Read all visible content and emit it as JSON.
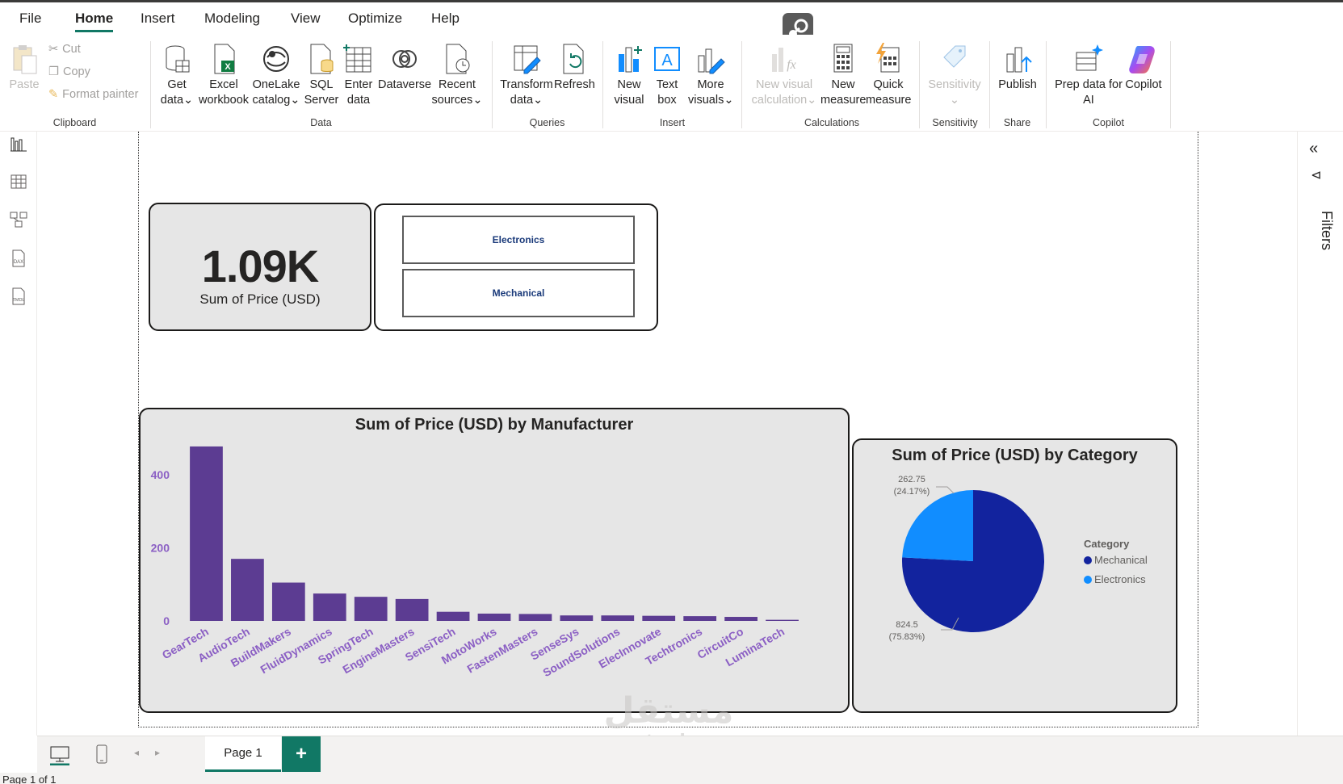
{
  "menu": {
    "tabs": [
      {
        "label": "File",
        "active": false
      },
      {
        "label": "Home",
        "active": true
      },
      {
        "label": "Insert",
        "active": false
      },
      {
        "label": "Modeling",
        "active": false
      },
      {
        "label": "View",
        "active": false
      },
      {
        "label": "Optimize",
        "active": false
      },
      {
        "label": "Help",
        "active": false
      }
    ]
  },
  "ribbon": {
    "clipboard": {
      "paste": "Paste",
      "cut": "Cut",
      "copy": "Copy",
      "format_painter": "Format painter",
      "group": "Clipboard"
    },
    "data": {
      "get_data": [
        "Get",
        "data"
      ],
      "excel": [
        "Excel",
        "workbook"
      ],
      "onelake": [
        "OneLake",
        "catalog"
      ],
      "sql": [
        "SQL",
        "Server"
      ],
      "enter": [
        "Enter",
        "data"
      ],
      "dataverse": [
        "Dataverse"
      ],
      "recent": [
        "Recent",
        "sources"
      ],
      "group": "Data"
    },
    "queries": {
      "transform": [
        "Transform",
        "data"
      ],
      "refresh": [
        "Refresh"
      ],
      "group": "Queries"
    },
    "insert": {
      "new_visual": [
        "New",
        "visual"
      ],
      "text_box": [
        "Text",
        "box"
      ],
      "more_visuals": [
        "More",
        "visuals"
      ],
      "group": "Insert"
    },
    "calculations": {
      "new_visual_calc": [
        "New visual",
        "calculation"
      ],
      "new_measure": [
        "New",
        "measure"
      ],
      "quick_measure": [
        "Quick",
        "measure"
      ],
      "group": "Calculations"
    },
    "sensitivity": {
      "label": [
        "Sensitivity"
      ],
      "group": "Sensitivity"
    },
    "share": {
      "publish": [
        "Publish"
      ],
      "group": "Share"
    },
    "copilot": {
      "prep": [
        "Prep data for",
        "AI"
      ],
      "copilot": [
        "Copilot"
      ],
      "group": "Copilot"
    }
  },
  "card": {
    "value": "1.09K",
    "label": "Sum of Price (USD)"
  },
  "slicer": {
    "items": [
      "Electronics",
      "Mechanical"
    ]
  },
  "filters_label": "Filters",
  "pages": {
    "tab": "Page 1",
    "add": "+"
  },
  "status": "Page 1 of 1",
  "watermark": {
    "ar": "مستقل",
    "en": "mostaql.com"
  },
  "colors": {
    "bar": "#5c3c92",
    "mechanical": "#12239e",
    "electronics": "#118dff",
    "accent": "#117865",
    "axis_label": "#8b5fc4"
  },
  "chart_data": [
    {
      "type": "bar",
      "title": "Sum of Price (USD) by Manufacturer",
      "categories": [
        "GearTech",
        "AudioTech",
        "BuildMakers",
        "FluidDynamics",
        "SpringTech",
        "EngineMasters",
        "SensiTech",
        "MotoWorks",
        "FastenMasters",
        "SenseSys",
        "SoundSolutions",
        "ElecInnovate",
        "Techtronics",
        "CircuitCo",
        "LuminaTech"
      ],
      "values": [
        478,
        170,
        105,
        75,
        66,
        60,
        25,
        20,
        19,
        15,
        15,
        14,
        13,
        11,
        3
      ],
      "yticks": [
        0,
        200,
        400
      ],
      "ylim": [
        0,
        500
      ],
      "grid": false
    },
    {
      "type": "pie",
      "title": "Sum of Price (USD) by Category",
      "legend_title": "Category",
      "legend_position": "right",
      "slices": [
        {
          "name": "Mechanical",
          "value": 824.5,
          "label_value": "824.5",
          "label_pct": "(75.83%)",
          "color": "#12239e"
        },
        {
          "name": "Electronics",
          "value": 262.75,
          "label_value": "262.75",
          "label_pct": "(24.17%)",
          "color": "#118dff"
        }
      ]
    }
  ]
}
